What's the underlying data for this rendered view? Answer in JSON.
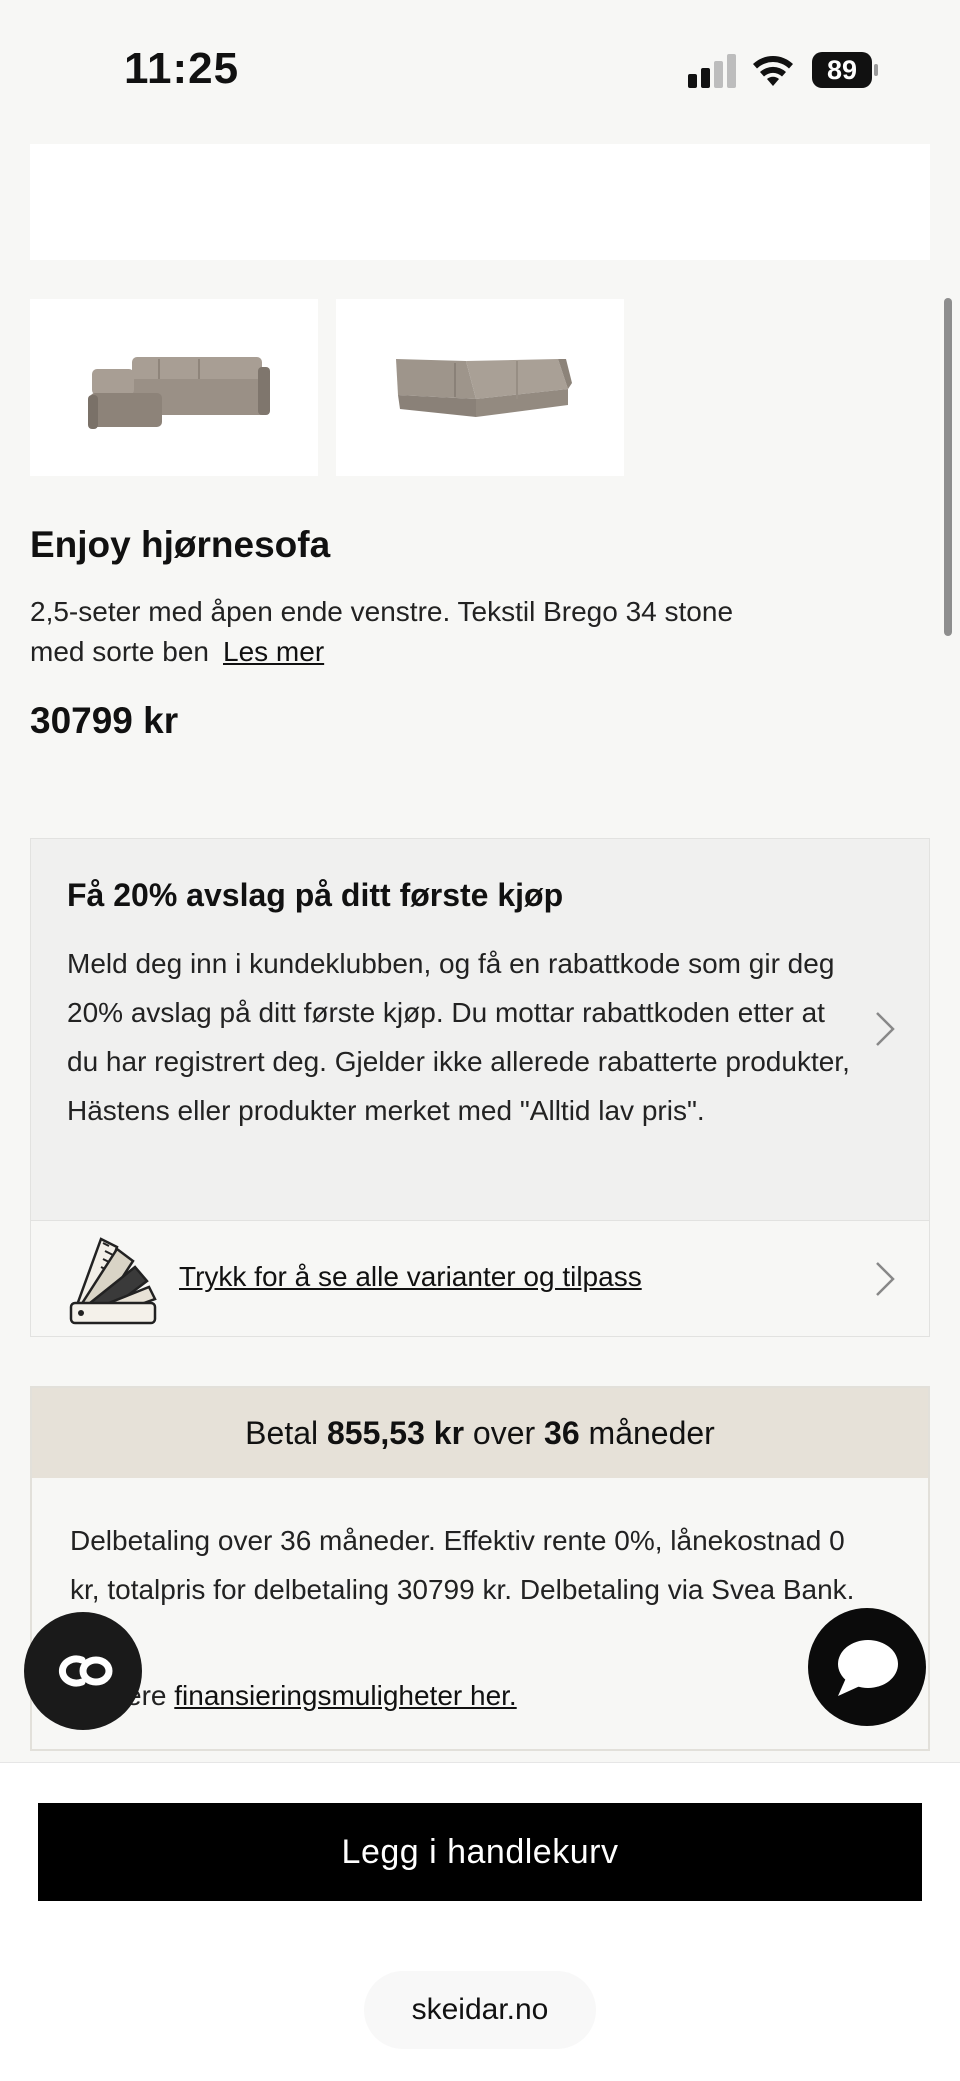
{
  "status_bar": {
    "time": "11:25",
    "battery": "89",
    "icons": [
      "signal-icon",
      "wifi-icon",
      "battery-icon"
    ]
  },
  "product": {
    "thumbnails": [
      "sofa-front-view",
      "sofa-back-view"
    ],
    "title": "Enjoy hjørnesofa",
    "description": "2,5-seter med åpen ende venstre. Tekstil Brego 34 stone med sorte ben",
    "read_more": "Les mer",
    "price": "30799 kr"
  },
  "promo": {
    "title": "Få 20% avslag på ditt første kjøp",
    "text": "Meld deg inn i kundeklubben, og få en rabattkode som gir deg 20% avslag på ditt første kjøp. Du mottar rabattkoden etter at du har registrert deg. Gjelder ikke allerede rabatterte produkter, Hästens eller produkter merket med \"Alltid lav pris\"."
  },
  "variants": {
    "link": "Trykk for å se alle varianter og tilpass"
  },
  "payment": {
    "head_prefix": "Betal",
    "amount": "855,53 kr",
    "head_mid": "over",
    "months": "36",
    "head_suffix": "måneder",
    "body": "Delbetaling over 36 måneder. Effektiv rente 0%, lånekostnad 0 kr, totalpris for delbetaling 30799 kr. Delbetaling via Svea Bank.",
    "more_prefix": "Se flere",
    "more_link": "finansieringsmuligheter her."
  },
  "cart": {
    "button": "Legg i handlekurv"
  },
  "browser": {
    "url": "skeidar.no"
  },
  "colors": {
    "background": "#f7f7f5",
    "payment_header": "#e6e1d8",
    "primary_button": "#000000"
  }
}
